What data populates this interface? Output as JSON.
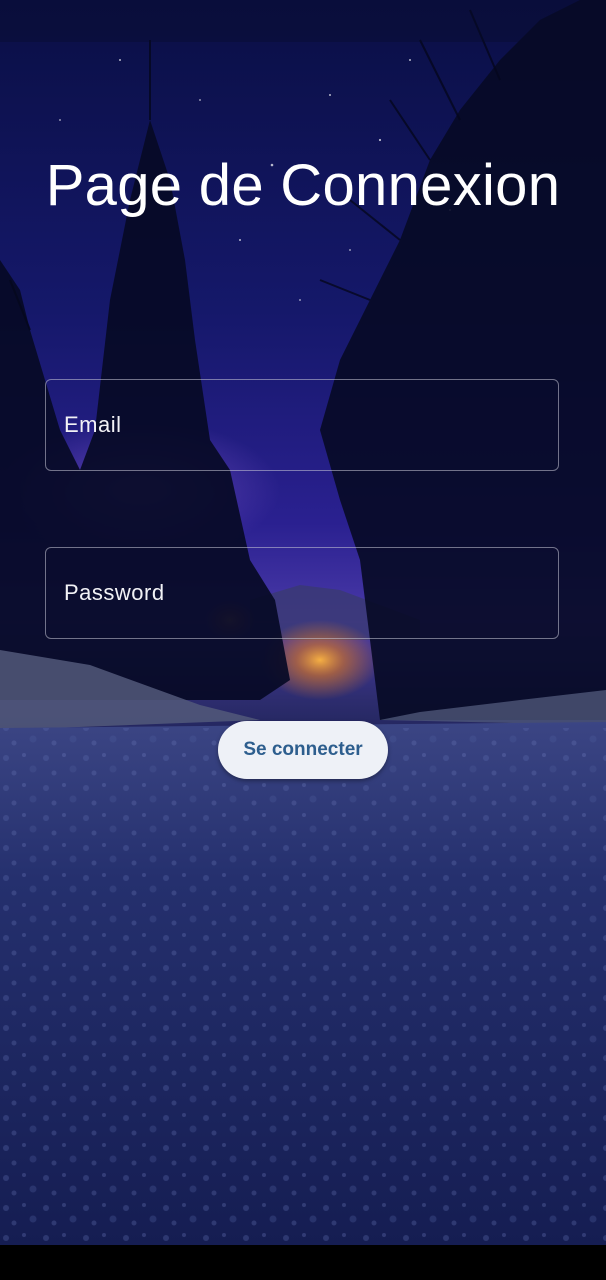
{
  "login": {
    "title": "Page de Connexion",
    "email_placeholder": "Email",
    "password_placeholder": "Password",
    "submit_label": "Se connecter"
  },
  "colors": {
    "sky_top": "#0d1250",
    "sky_mid": "#1d1f78",
    "horizon_glow": "#5a3b9a",
    "road": "#222a6a",
    "button_bg": "#eef1f7",
    "button_text": "#2d5e8e"
  }
}
